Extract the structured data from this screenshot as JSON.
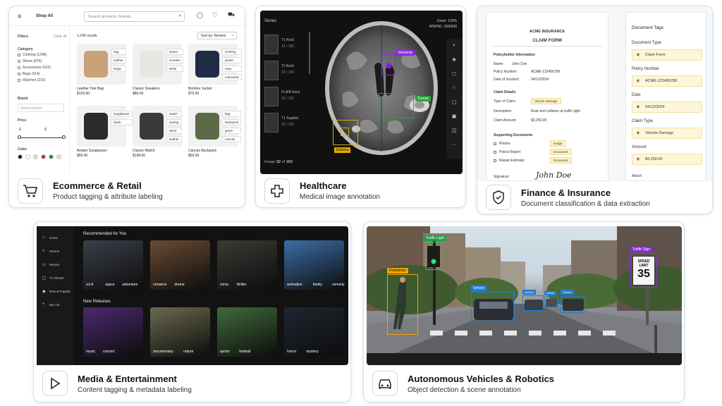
{
  "cards": {
    "ecommerce": {
      "title": "Ecommerce & Retail",
      "subtitle": "Product tagging & attribute labeling",
      "icon": "shopping-cart-icon",
      "screen": {
        "nav_title": "Shop All",
        "search_placeholder": "Search products, brands...",
        "results": "1,248 results",
        "sort": "Sort by: Newest",
        "filters": {
          "label": "Filters",
          "clear": "Clear all",
          "category_label": "Category",
          "categories": [
            "Clothing (1248)",
            "Shoes (876)",
            "Accessories (632)",
            "Bags (314)",
            "Watches (210)"
          ],
          "brand_label": "Brand",
          "brand_placeholder": "Search brand",
          "price_label": "Price",
          "price_min": "$",
          "price_max": "$",
          "color_label": "Color",
          "colors": [
            "#111111",
            "#ffffff",
            "#d9d9d9",
            "#d0241e",
            "#1e8a4a",
            "#f1d7b5"
          ]
        },
        "products": [
          {
            "name": "Leather Tote Bag",
            "price": "$129.00",
            "tags": [
              "bag",
              "leather",
              "beige"
            ],
            "color": "#c9a27a"
          },
          {
            "name": "Classic Sneakers",
            "price": "$89.00",
            "tags": [
              "shoes",
              "sneaker",
              "white"
            ],
            "color": "#e9e7e2"
          },
          {
            "name": "Bomber Jacket",
            "price": "$79.00",
            "tags": [
              "clothing",
              "jacket",
              "navy",
              "outerwear"
            ],
            "color": "#1f2a44"
          },
          {
            "name": "Aviator Sunglasses",
            "price": "$59.00",
            "tags": [
              "sunglasses",
              "black"
            ],
            "color": "#2b2b2b"
          },
          {
            "name": "Classic Watch",
            "price": "$149.00",
            "tags": [
              "watch",
              "analog",
              "silver",
              "leather"
            ],
            "color": "#3a3a3a"
          },
          {
            "name": "Canvas Backpack",
            "price": "$69.00",
            "tags": [
              "bag",
              "backpack",
              "green",
              "canvas"
            ],
            "color": "#5b6b46"
          }
        ]
      }
    },
    "healthcare": {
      "title": "Healthcare",
      "subtitle": "Medical image annotation",
      "icon": "medical-cross-icon",
      "screen": {
        "series_label": "Series",
        "series": [
          {
            "name": "T1 Axial",
            "count": "32 / 150"
          },
          {
            "name": "T2 Axial",
            "count": "32 / 150"
          },
          {
            "name": "FLAIR Axial",
            "count": "32 / 150"
          },
          {
            "name": "T1 Sagittal",
            "count": "18 / 150"
          }
        ],
        "zoom": "Zoom: 120%",
        "window": "WW/WL: 500/600",
        "image_prefix": "Image",
        "image_current": "32",
        "image_of": "of",
        "image_total": "150",
        "annotations": [
          "Ventricle",
          "Tumor",
          "Edema"
        ]
      }
    },
    "finance": {
      "title": "Finance & Insurance",
      "subtitle": "Document classification & data extraction",
      "icon": "shield-icon",
      "form": {
        "company": "ACME INSURANCE",
        "title": "CLAIM FORM",
        "section1": "Policyholder Information",
        "name_label": "Name:",
        "name": "John Doe",
        "policy_label": "Policy Number:",
        "policy": "ACME-123456789",
        "date_label": "Date of Incident:",
        "date": "04/12/2024",
        "section2": "Claim Details",
        "type_label": "Type of Claim:",
        "type": "Vehicle Damage",
        "desc_label": "Description:",
        "desc": "Rear-end collision at traffic light.",
        "amount_label": "Claim Amount:",
        "amount": "$3,250.00",
        "section3": "Supporting Documents",
        "docs": [
          {
            "name": "Photos",
            "tag": "Image"
          },
          {
            "name": "Police Report",
            "tag": "Document"
          },
          {
            "name": "Repair Estimate",
            "tag": "Document"
          }
        ],
        "signature_label": "Signature:",
        "signature": "John Doe"
      },
      "tags": {
        "title": "Document Tags",
        "items": [
          {
            "label": "Document Type",
            "value": "Claim Form"
          },
          {
            "label": "Policy Number",
            "value": "ACME-123456789"
          },
          {
            "label": "Date",
            "value": "04/12/2024"
          },
          {
            "label": "Claim Type",
            "value": "Vehicle Damage"
          },
          {
            "label": "Amount",
            "value": "$3,250.00"
          }
        ],
        "partial": "Attach"
      }
    },
    "media": {
      "title": "Media & Entertainment",
      "subtitle": "Content tagging & metadata labeling",
      "icon": "play-icon",
      "screen": {
        "nav": [
          "Home",
          "Search",
          "Movies",
          "TV Shows",
          "New & Popular",
          "My List"
        ],
        "recommended": "Recommended for You",
        "new_releases": "New Releases",
        "row1": [
          {
            "tags": [
              "sci-fi",
              "space",
              "adventure"
            ],
            "color": "#3b3f4a"
          },
          {
            "tags": [
              "romance",
              "drama"
            ],
            "color": "#6b4b33"
          },
          {
            "tags": [
              "crime",
              "thriller"
            ],
            "color": "#3a3a36"
          },
          {
            "tags": [
              "animation",
              "family",
              "comedy"
            ],
            "color": "#3b6ea8"
          }
        ],
        "row2": [
          {
            "tags": [
              "music",
              "concert"
            ],
            "color": "#4b2a6e"
          },
          {
            "tags": [
              "documentary",
              "nature"
            ],
            "color": "#6b6a4e"
          },
          {
            "tags": [
              "sports",
              "football"
            ],
            "color": "#3f6b3b"
          },
          {
            "tags": [
              "horror",
              "mystery"
            ],
            "color": "#1f2630"
          }
        ]
      }
    },
    "autonomous": {
      "title": "Autonomous Vehicles & Robotics",
      "subtitle": "Object detection & scene annotation",
      "icon": "car-icon",
      "labels": {
        "traffic_light": "Traffic Light",
        "traffic_sign": "Traffic Sign",
        "pedestrian": "Pedestrian",
        "vehicle": "Vehicle"
      },
      "sign_text_top": "SPEED",
      "sign_text_mid": "LIMIT",
      "sign_text_num": "35"
    }
  }
}
